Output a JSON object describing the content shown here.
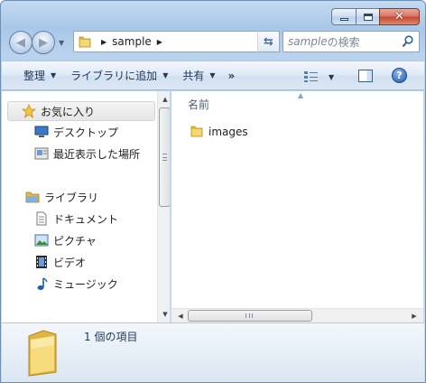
{
  "window": {
    "minimize_icon": "minimize-icon",
    "maximize_icon": "maximize-icon",
    "close_icon": "close-icon"
  },
  "address_bar": {
    "path": [
      "sample"
    ],
    "back_icon": "back-arrow-icon",
    "forward_icon": "forward-arrow-icon"
  },
  "search": {
    "placeholder_query": "sample",
    "placeholder_suffix": "の検索"
  },
  "toolbar": {
    "organize": "整理",
    "add_to_library": "ライブラリに追加",
    "share": "共有",
    "more": "»"
  },
  "nav_pane": {
    "favorites": "お気に入り",
    "desktop": "デスクトップ",
    "recent": "最近表示した場所",
    "libraries": "ライブラリ",
    "documents": "ドキュメント",
    "pictures": "ピクチャ",
    "videos": "ビデオ",
    "music": "ミュージック"
  },
  "content": {
    "column_name": "名前",
    "files": [
      {
        "name": "images",
        "type": "folder"
      }
    ]
  },
  "details": {
    "item_count": "1 個の項目"
  },
  "colors": {
    "frame": "#b9d3ee",
    "toolbar_text": "#1e395b",
    "folder": "#f2cf5b"
  }
}
